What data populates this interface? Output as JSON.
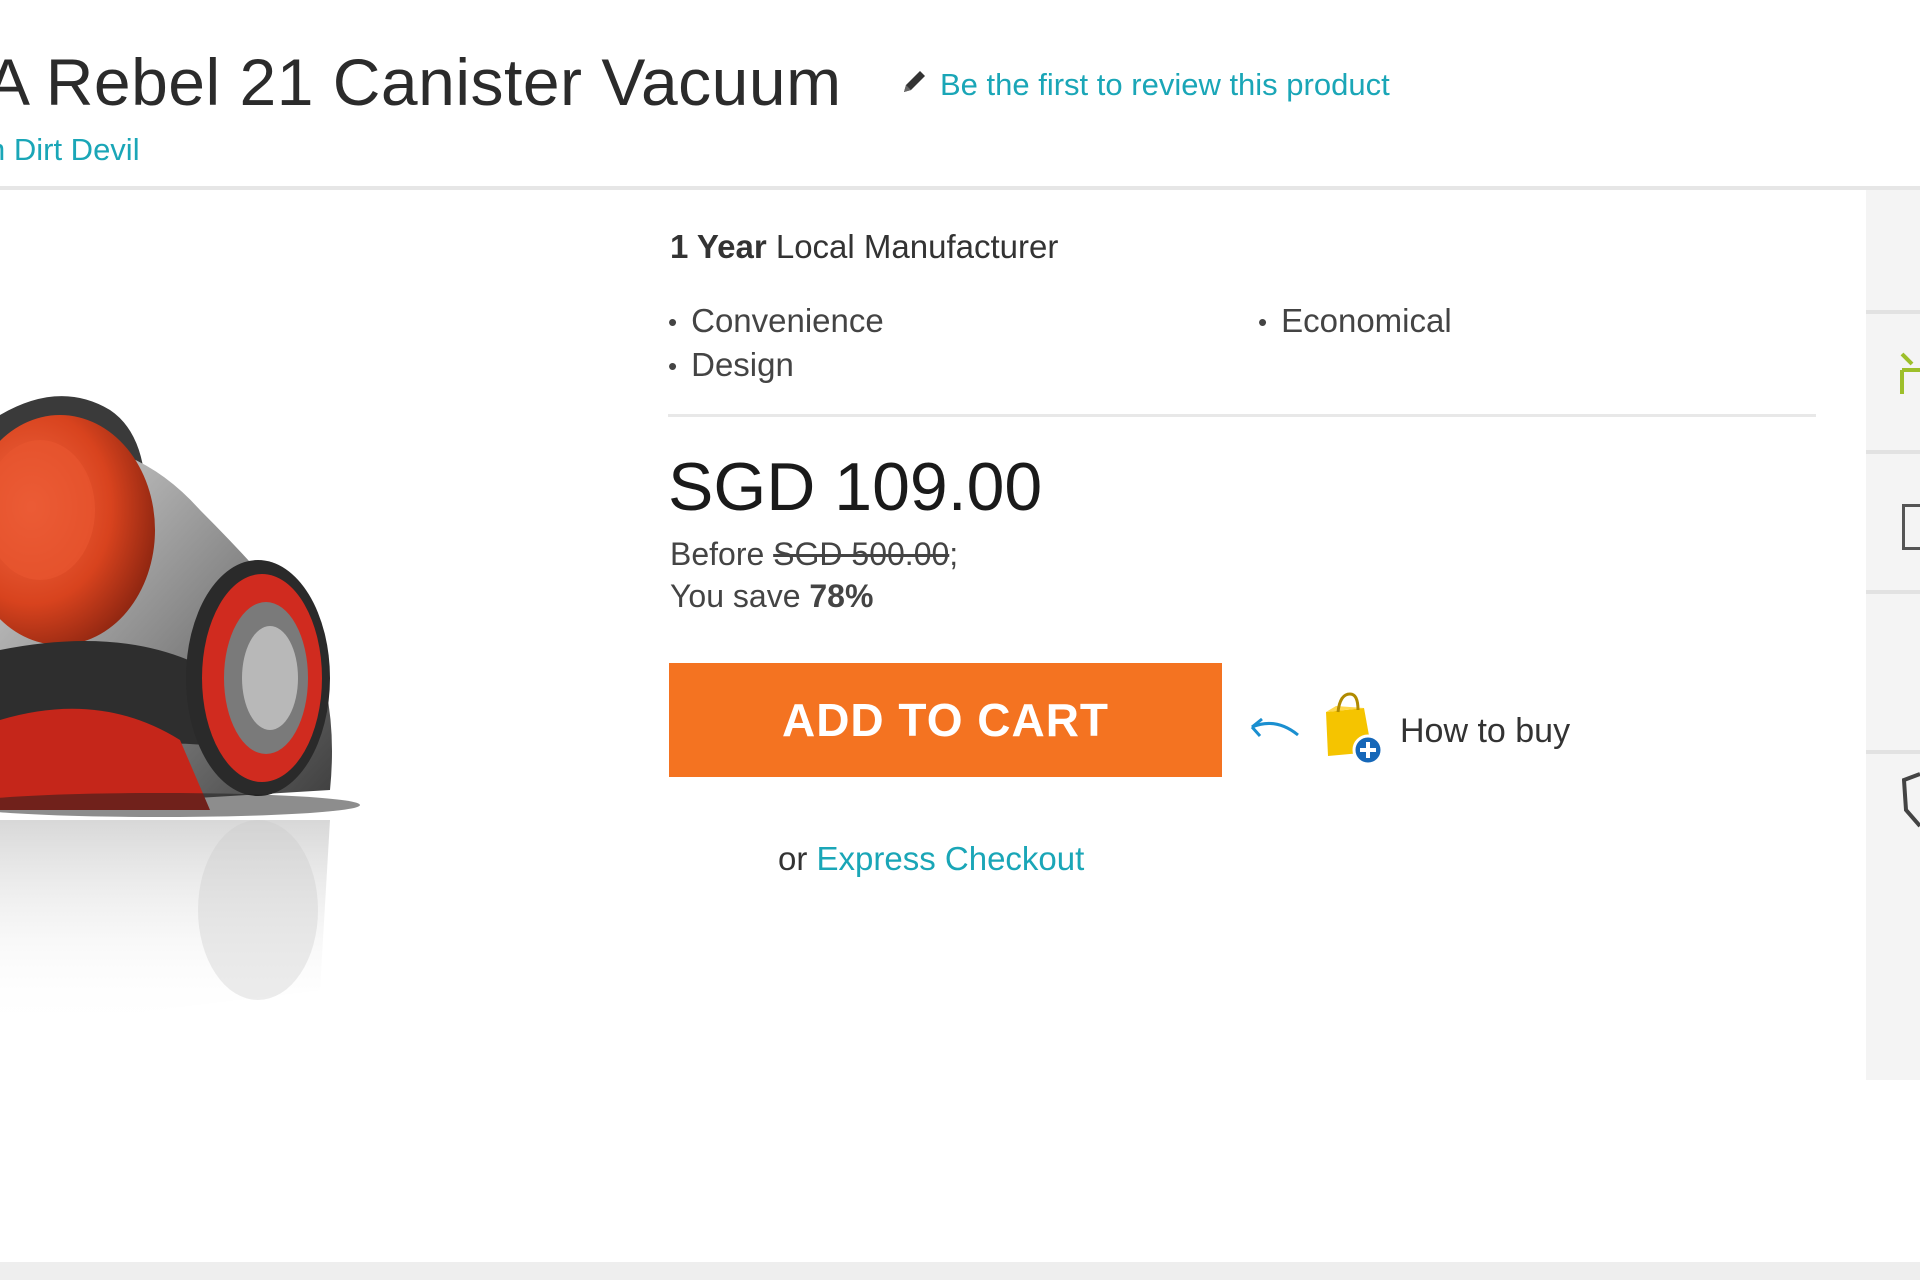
{
  "header": {
    "title": "A Rebel 21 Canister Vacuum",
    "review_link": "Be the first to review this product",
    "brand_link": "n Dirt Devil"
  },
  "warranty": {
    "bold": "1 Year",
    "rest": " Local Manufacturer"
  },
  "features": [
    "Convenience",
    "Economical",
    "Design"
  ],
  "pricing": {
    "price": "SGD 109.00",
    "before_label": "Before ",
    "before_price": "SGD 500.00",
    "before_suffix": ";",
    "save_label": "You save ",
    "save_percent": "78%"
  },
  "actions": {
    "add_to_cart": "ADD TO CART",
    "how_to_buy": "How to buy",
    "express_prefix": "or ",
    "express_link": "Express Checkout"
  },
  "colors": {
    "accent": "#f47321",
    "link": "#1aa6b7"
  },
  "icons": {
    "review": "pencil-icon",
    "how_to_buy": "shopping-bag-plus-icon",
    "arrow": "arrow-left-icon"
  }
}
